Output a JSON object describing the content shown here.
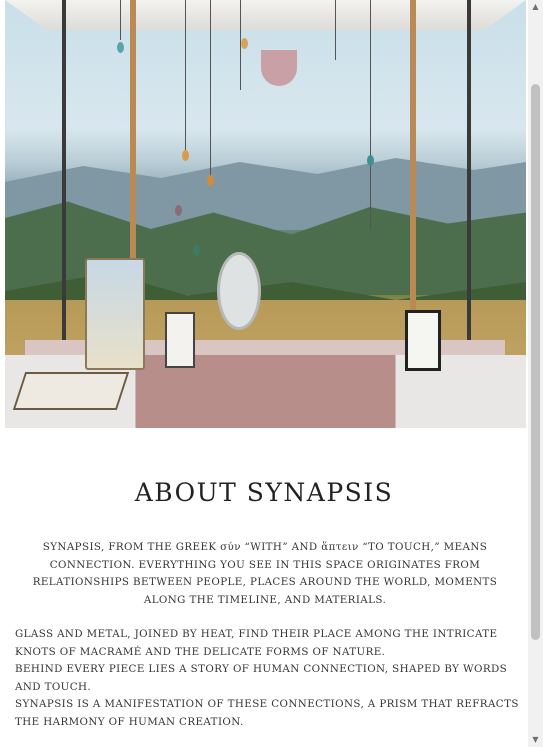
{
  "hero": {
    "image_alt": "Synapsis market stand with hanging glass pieces overlooking mountains"
  },
  "about": {
    "title": "ABOUT SYNAPSIS",
    "intro": "SYNAPSIS, FROM THE GREEK σύν “WITH” AND ἅπτειν “TO TOUCH,” MEANS CONNECTION. EVERYTHING YOU SEE IN THIS SPACE ORIGINATES FROM RELATIONSHIPS BETWEEN PEOPLE, PLACES AROUND THE WORLD, MOMENTS ALONG THE TIMELINE, AND MATERIALS.",
    "paragraphs": [
      "GLASS AND METAL, JOINED BY HEAT, FIND THEIR PLACE AMONG THE INTRICATE KNOTS OF MACRAMÉ AND THE DELICATE FORMS OF NATURE.",
      "BEHIND EVERY PIECE LIES A STORY OF HUMAN CONNECTION, SHAPED BY WORDS AND TOUCH.",
      "SYNAPSIS IS A MANIFESTATION OF THESE CONNECTIONS, A PRISM THAT REFRACTS THE HARMONY OF HUMAN CREATION."
    ]
  },
  "scrollbar": {
    "up_icon": "triangle-up-icon",
    "down_icon": "triangle-down-icon",
    "up_glyph": "▲",
    "down_glyph": "▼"
  }
}
